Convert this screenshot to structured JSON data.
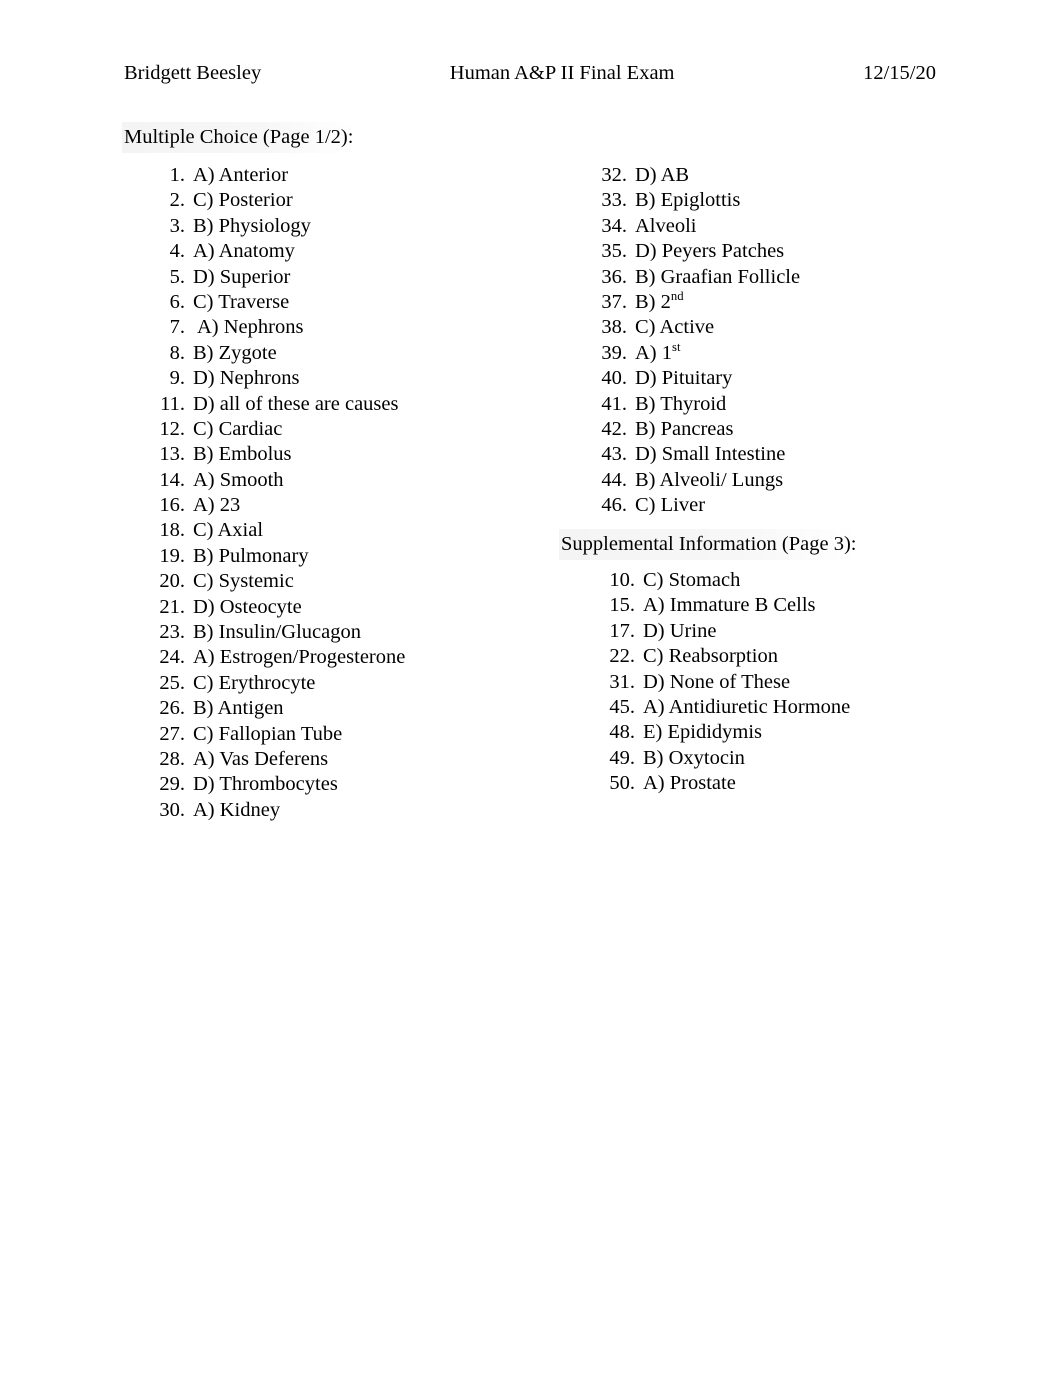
{
  "header": {
    "author": "Bridgett Beesley",
    "title": "Human A&P II Final Exam",
    "date": "12/15/20"
  },
  "sections": {
    "multiple_choice": {
      "heading": "Multiple Choice (Page 1/2):"
    },
    "supplemental": {
      "heading": "Supplemental Information (Page 3):"
    }
  },
  "answers": {
    "left_column": [
      {
        "num": "1.",
        "text": "A) Anterior"
      },
      {
        "num": "2.",
        "text": "C) Posterior"
      },
      {
        "num": "3.",
        "text": "B) Physiology"
      },
      {
        "num": "4.",
        "text": "A) Anatomy"
      },
      {
        "num": "5.",
        "text": "D) Superior"
      },
      {
        "num": "6.",
        "text": "C) Traverse"
      },
      {
        "num": "7.",
        "text": " A) Nephrons"
      },
      {
        "num": "8.",
        "text": "B) Zygote"
      },
      {
        "num": "9.",
        "text": "D) Nephrons"
      },
      {
        "num": "11.",
        "text": "D) all of these are causes"
      },
      {
        "num": "12.",
        "text": "C) Cardiac"
      },
      {
        "num": "13.",
        "text": "B) Embolus"
      },
      {
        "num": "14.",
        "text": "A) Smooth"
      },
      {
        "num": "16.",
        "text": "A) 23"
      },
      {
        "num": "18.",
        "text": "C) Axial"
      },
      {
        "num": "19.",
        "text": "B) Pulmonary"
      },
      {
        "num": "20.",
        "text": "C) Systemic"
      },
      {
        "num": "21.",
        "text": "D) Osteocyte"
      },
      {
        "num": "23.",
        "text": "B) Insulin/Glucagon"
      },
      {
        "num": "24.",
        "text": "A) Estrogen/Progesterone"
      },
      {
        "num": "25.",
        "text": "C) Erythrocyte"
      },
      {
        "num": "26.",
        "text": "B) Antigen"
      },
      {
        "num": "27.",
        "text": "C) Fallopian Tube"
      },
      {
        "num": "28.",
        "text": "A) Vas Deferens"
      },
      {
        "num": "29.",
        "text": "D) Thrombocytes"
      },
      {
        "num": "30.",
        "text": "A) Kidney"
      }
    ],
    "right_column": [
      {
        "num": "32.",
        "text": "D) AB"
      },
      {
        "num": "33.",
        "text": "B) Epiglottis"
      },
      {
        "num": "34.",
        "text": "Alveoli"
      },
      {
        "num": "35.",
        "text": "D) Peyers Patches"
      },
      {
        "num": "36.",
        "text": "B) Graafian Follicle"
      },
      {
        "num": "37.",
        "text": "B) 2",
        "sup": "nd"
      },
      {
        "num": "38.",
        "text": "C) Active"
      },
      {
        "num": "39.",
        "text": "A) 1",
        "sup": "st"
      },
      {
        "num": "40.",
        "text": "D) Pituitary"
      },
      {
        "num": "41.",
        "text": "B) Thyroid"
      },
      {
        "num": "42.",
        "text": "B) Pancreas"
      },
      {
        "num": "43.",
        "text": "D) Small Intestine"
      },
      {
        "num": "44.",
        "text": "B) Alveoli/ Lungs"
      },
      {
        "num": "46.",
        "text": "C) Liver"
      }
    ],
    "supplemental_column": [
      {
        "num": "10.",
        "text": "C) Stomach"
      },
      {
        "num": "15.",
        "text": "A) Immature B Cells"
      },
      {
        "num": "17.",
        "text": "D) Urine"
      },
      {
        "num": "22.",
        "text": "C) Reabsorption"
      },
      {
        "num": "31.",
        "text": "D) None of These"
      },
      {
        "num": "45.",
        "text": "A) Antidiuretic Hormone"
      },
      {
        "num": "48.",
        "text": "E) Epididymis"
      },
      {
        "num": "49.",
        "text": "B) Oxytocin"
      },
      {
        "num": "50.",
        "text": "A) Prostate"
      }
    ]
  }
}
